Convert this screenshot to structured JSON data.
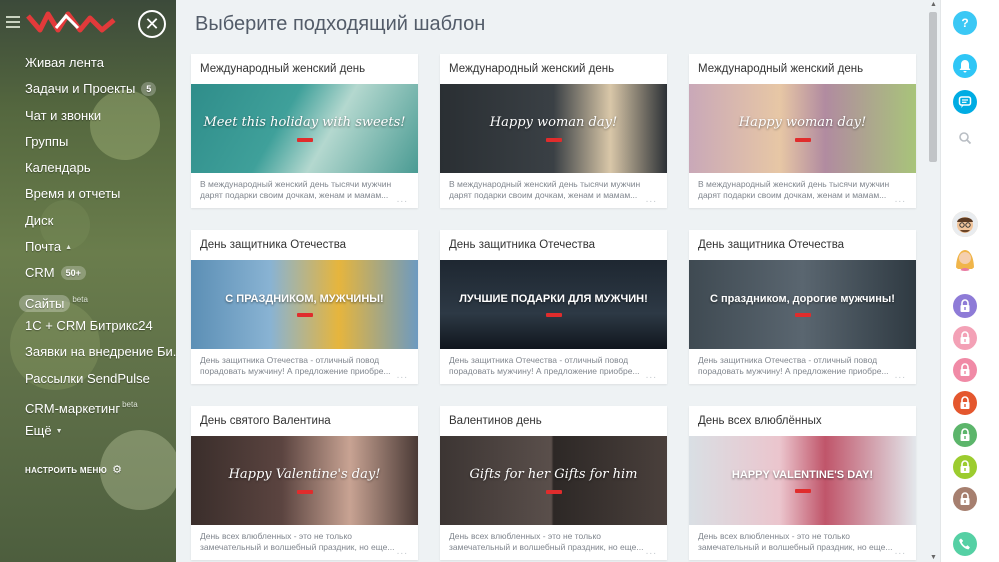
{
  "sidebar": {
    "close_label": "✕",
    "menu": [
      {
        "label": "Живая лента"
      },
      {
        "label": "Задачи и Проекты",
        "count": "5"
      },
      {
        "label": "Чат и звонки"
      },
      {
        "label": "Группы"
      },
      {
        "label": "Календарь"
      },
      {
        "label": "Время и отчеты"
      },
      {
        "label": "Диск"
      },
      {
        "label": "Почта",
        "arrow": "▲"
      },
      {
        "label": "CRM",
        "count": "50+"
      },
      {
        "label": "Сайты",
        "sup": "beta",
        "active": true
      },
      {
        "label": "1С + CRM Битрикс24"
      },
      {
        "label": "Заявки на внедрение Би..."
      },
      {
        "label": "Рассылки SendPulse"
      },
      {
        "label": "CRM-маркетинг",
        "sup": "beta"
      },
      {
        "label": "Ещё",
        "arrow": "▼"
      }
    ],
    "settings_label": "НАСТРОИТЬ МЕНЮ"
  },
  "main": {
    "title": "Выберите подходящий шаблон",
    "cards": [
      {
        "title": "Международный женский день",
        "desc": "В международный женский день тысячи мужчин дарят подарки своим дочкам, женам и мамам...",
        "banner": "Meet this holiday with sweets!",
        "banner_style": "script"
      },
      {
        "title": "Международный женский день",
        "desc": "В международный женский день тысячи мужчин дарят подарки своим дочкам, женам и мамам...",
        "banner": "Happy woman day!",
        "banner_style": "script"
      },
      {
        "title": "Международный женский день",
        "desc": "В международный женский день тысячи мужчин дарят подарки своим дочкам, женам и мамам...",
        "banner": "Happy woman day!",
        "banner_style": "script"
      },
      {
        "title": "День защитника Отечества",
        "desc": "День защитника Отечества - отличный повод порадовать мужчину! А предложение приобре...",
        "banner": "С ПРАЗДНИКОМ, МУЖЧИНЫ!",
        "banner_style": "bold"
      },
      {
        "title": "День защитника Отечества",
        "desc": "День защитника Отечества - отличный повод порадовать мужчину! А предложение приобре...",
        "banner": "ЛУЧШИЕ ПОДАРКИ ДЛЯ МУЖЧИН!",
        "banner_style": "bold"
      },
      {
        "title": "День защитника Отечества",
        "desc": "День защитника Отечества - отличный повод порадовать мужчину! А предложение приобре...",
        "banner": "С праздником, дорогие мужчины!",
        "banner_style": "bold"
      },
      {
        "title": "День святого Валентина",
        "desc": "День всех влюбленных - это не только замечательный и волшебный праздник, но еще...",
        "banner": "Happy Valentine's day!",
        "banner_style": "script"
      },
      {
        "title": "Валентинов день",
        "desc": "День всех влюбленных - это не только замечательный и волшебный праздник, но еще...",
        "banner": "Gifts for her   Gifts for him",
        "banner_style": "script"
      },
      {
        "title": "День всех влюблённых",
        "desc": "День всех влюбленных - это не только замечательный и волшебный праздник, но еще...",
        "banner": "HAPPY VALENTINE'S DAY!",
        "banner_style": "bold"
      }
    ],
    "more_label": "..."
  },
  "rail": {
    "help_label": "?"
  },
  "colors": {
    "accent": "#2fc6f6",
    "help": "#3bc8f5",
    "notify": "#2fc6f6",
    "chat": "#00ace3",
    "phone": "#55d0a4",
    "locks": [
      "#8e7bd7",
      "#f3a1b6",
      "#f08aa6",
      "#e4572e",
      "#5cb56b",
      "#9ccc2f",
      "#a67f6f"
    ]
  }
}
